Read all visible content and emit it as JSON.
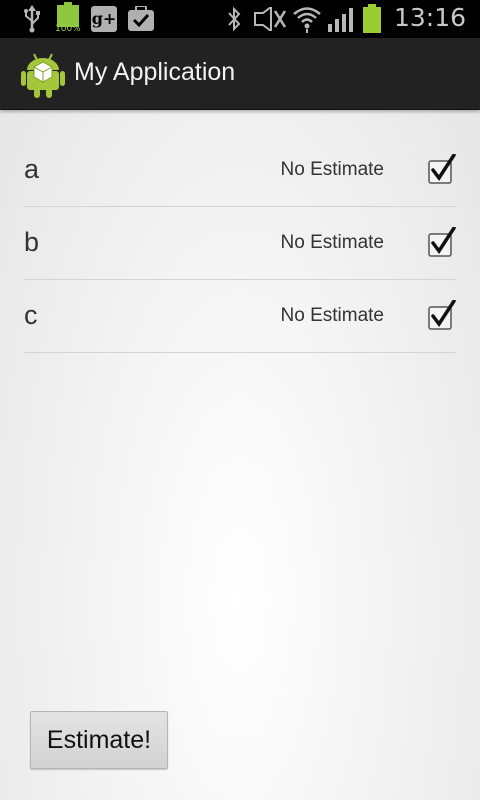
{
  "status_bar": {
    "time": "13:16",
    "battery_label": "100%",
    "icons": [
      "usb-icon",
      "battery-full-icon",
      "google-plus-icon",
      "briefcase-check-icon",
      "bluetooth-icon",
      "mute-icon",
      "wifi-icon",
      "signal-icon",
      "battery-icon"
    ]
  },
  "action_bar": {
    "title": "My Application",
    "icon": "android-app-icon"
  },
  "list": {
    "items": [
      {
        "name": "a",
        "estimate": "No Estimate",
        "checked": true
      },
      {
        "name": "b",
        "estimate": "No Estimate",
        "checked": true
      },
      {
        "name": "c",
        "estimate": "No Estimate",
        "checked": true
      }
    ]
  },
  "actions": {
    "estimate_label": "Estimate!"
  },
  "colors": {
    "status_bar": "#000000",
    "action_bar": "#222222",
    "battery_green": "#8ec63f",
    "android_green": "#a4c639"
  }
}
